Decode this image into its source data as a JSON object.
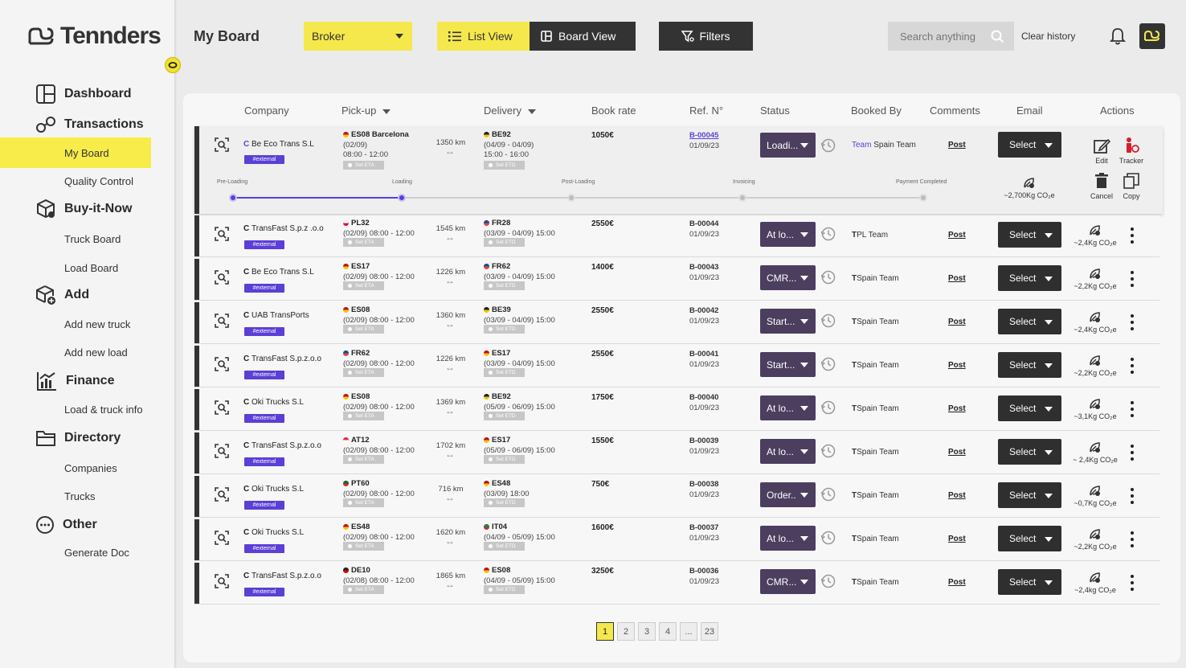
{
  "brand": {
    "name": "Tennders"
  },
  "sidebar": {
    "groups": [
      {
        "label": "Dashboard",
        "icon": "dashboard-icon"
      },
      {
        "label": "Transactions",
        "icon": "transactions-icon",
        "items": [
          "My Board",
          "Quality Control"
        ]
      },
      {
        "label": "Buy-it-Now",
        "icon": "buy-it-now-icon",
        "items": [
          "Truck Board",
          "Load Board"
        ]
      },
      {
        "label": "Add",
        "icon": "add-icon",
        "items": [
          "Add new truck",
          "Add new load"
        ]
      },
      {
        "label": "Finance",
        "icon": "finance-icon",
        "items": [
          "Load & truck info"
        ]
      },
      {
        "label": "Directory",
        "icon": "folder-icon",
        "items": [
          "Companies",
          "Trucks"
        ]
      },
      {
        "label": "Other",
        "icon": "more-circle-icon",
        "items": [
          "Generate Doc"
        ]
      }
    ],
    "active": "My Board"
  },
  "topbar": {
    "title": "My Board",
    "broker": "Broker",
    "list_view": "List View",
    "board_view": "Board View",
    "filters": "Filters",
    "search_placeholder": "Search anything",
    "clear_history": "Clear history"
  },
  "table": {
    "columns": [
      "Company",
      "Pick-up",
      "Delivery",
      "Book rate",
      "Ref. N°",
      "Status",
      "Booked By",
      "Comments",
      "Email",
      "Actions"
    ],
    "eta_label": "Set ETA",
    "etd_label": "Set ETD",
    "external_tag": "#external",
    "select_label": "Select",
    "post_label": "Post",
    "expanded": {
      "progress_steps": [
        "Pre-Loading",
        "Loading",
        "Post-Loading",
        "Invoicing",
        "Payment Completed"
      ],
      "progress_current": 1,
      "actions": {
        "edit": "Edit",
        "tracker": "Tracker",
        "cancel": "Cancel",
        "copy": "Copy"
      },
      "team_prefix": "Team"
    },
    "rows": [
      {
        "company": "Be Eco Trans S.L",
        "pick_code": "ES08 Barcelona",
        "pick_line1": "(02/09)",
        "pick_line2": "08:00 - 12:00",
        "km": "1350 km",
        "del_code": "BE92",
        "del_line1": "(04/09 - 04/09)",
        "del_line2": "15:00 - 16:00",
        "rate": "1050€",
        "ref": "B-00045",
        "ref_date": "01/09/23",
        "status": "Loadi...",
        "team": "Spain Team",
        "co2": "~2,700Kg CO₂e"
      },
      {
        "company": "TransFast S.p.z .o.o",
        "pick_code": "PL32",
        "pick_line1": "(02/09) 08:00 - 12:00",
        "km": "1545 km",
        "del_code": "FR28",
        "del_line1": "(03/09 - 04/09) 15:00",
        "rate": "2550€",
        "ref": "B-00044",
        "ref_date": "01/09/23",
        "status": "At lo...",
        "team": "PL Team",
        "co2": "~2,4Kg CO₂e"
      },
      {
        "company": "Be Eco Trans S.L",
        "pick_code": "ES17",
        "pick_line1": "(02/09) 08:00 - 12:00",
        "km": "1226 km",
        "del_code": "FR62",
        "del_line1": "(03/09 - 04/09) 15:00",
        "rate": "1400€",
        "ref": "B-00043",
        "ref_date": "01/09/23",
        "status": "CMR...",
        "team": "Spain Team",
        "co2": "~2,2Kg CO₂e"
      },
      {
        "company": "UAB TransPorts",
        "pick_code": "ES08",
        "pick_line1": "(02/09) 08:00 - 12:00",
        "km": "1360 km",
        "del_code": "BE39",
        "del_line1": "(03/09 - 04/09) 15:00",
        "rate": "2550€",
        "ref": "B-00042",
        "ref_date": "01/09/23",
        "status": "Start...",
        "team": "Spain Team",
        "co2": "~2,4Kg CO₂e"
      },
      {
        "company": "TransFast S.p.z.o.o",
        "pick_code": "FR62",
        "pick_line1": "(02/09) 08:00 - 12:00",
        "km": "1226 km",
        "del_code": "ES17",
        "del_line1": "(03/09 - 04/09) 15:00",
        "rate": "2550€",
        "ref": "B-00041",
        "ref_date": "01/09/23",
        "status": "Start...",
        "team": "Spain Team",
        "co2": "~2,2Kg CO₂e"
      },
      {
        "company": "Oki Trucks S.L",
        "pick_code": "ES08",
        "pick_line1": "(02/09) 08:00 - 12:00",
        "km": "1369 km",
        "del_code": "BE92",
        "del_line1": "(05/09 - 06/09) 15:00",
        "rate": "1750€",
        "ref": "B-00040",
        "ref_date": "01/09/23",
        "status": "At lo...",
        "team": "Spain Team",
        "co2": "~3,1Kg CO₂e"
      },
      {
        "company": "TransFast S.p.z.o.o",
        "pick_code": "AT12",
        "pick_line1": "(02/09) 08:00 - 12:00",
        "km": "1702 km",
        "del_code": "ES17",
        "del_line1": "(05/09 - 06/09) 15:00",
        "rate": "1550€",
        "ref": "B-00039",
        "ref_date": "01/09/23",
        "status": "At lo...",
        "team": "Spain Team",
        "co2": "~ 2,4Kg CO₂e"
      },
      {
        "company": "Oki Trucks S.L",
        "pick_code": "PT60",
        "pick_line1": "(02/09) 08:00 - 12:00",
        "km": "716 km",
        "del_code": "ES48",
        "del_line1": "(03/09) 18:00",
        "rate": "750€",
        "ref": "B-00038",
        "ref_date": "01/09/23",
        "status": "Order..",
        "team": "Spain Team",
        "co2": "~0,7Kg CO₂e"
      },
      {
        "company": "Oki Trucks S.L",
        "pick_code": "ES48",
        "pick_line1": "(02/09) 08:00 - 12:00",
        "km": "1620 km",
        "del_code": "IT04",
        "del_line1": "(04/09 - 05/09) 15:00",
        "rate": "1600€",
        "ref": "B-00037",
        "ref_date": "01/09/23",
        "status": "At lo...",
        "team": "Spain Team",
        "co2": "~2,2Kg CO₂e"
      },
      {
        "company": "TransFast S.p.z.o.o",
        "pick_code": "DE10",
        "pick_line1": "(02/08) 08:00 - 12:00",
        "km": "1865 km",
        "del_code": "ES08",
        "del_line1": "(04/09 - 05/09) 15:00",
        "rate": "3250€",
        "ref": "B-00036",
        "ref_date": "01/09/23",
        "status": "CMR...",
        "team": "Spain Team",
        "co2": "~2,4kg CO₂e"
      }
    ]
  },
  "pagination": {
    "pages": [
      "1",
      "2",
      "3",
      "4",
      "...",
      "23"
    ],
    "active": "1"
  },
  "colors": {
    "accent": "#f5e84d",
    "dark": "#333333",
    "status": "#4b3e5f",
    "external": "#5b3fd6",
    "progress": "#5b3fd6"
  }
}
